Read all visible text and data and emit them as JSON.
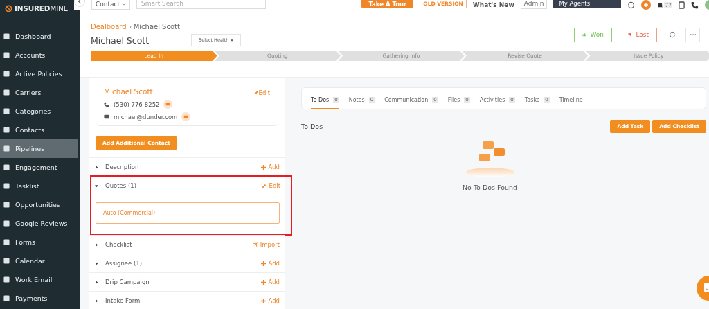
{
  "brand": {
    "name_bold": "INSURED",
    "name_light": "MINE"
  },
  "sidebar": {
    "items": [
      {
        "label": "Dashboard",
        "selected": false
      },
      {
        "label": "Accounts",
        "selected": false
      },
      {
        "label": "Active Policies",
        "selected": false
      },
      {
        "label": "Carriers",
        "selected": false
      },
      {
        "label": "Categories",
        "selected": false
      },
      {
        "label": "Contacts",
        "selected": false
      },
      {
        "label": "Pipelines",
        "selected": true
      },
      {
        "label": "Engagement",
        "selected": false
      },
      {
        "label": "Tasklist",
        "selected": false
      },
      {
        "label": "Opportunities",
        "selected": false
      },
      {
        "label": "Google Reviews",
        "selected": false
      },
      {
        "label": "Forms",
        "selected": false
      },
      {
        "label": "Calendar",
        "selected": false
      },
      {
        "label": "Work Email",
        "selected": false
      },
      {
        "label": "Payments",
        "selected": false
      }
    ]
  },
  "topbar": {
    "search_type": "Contact",
    "search_placeholder": "Smart Search",
    "tour": "Take A Tour",
    "old_version": "OLD VERSION",
    "whats_new": "What's New",
    "role": "Admin",
    "agents": "My Agents",
    "notifications": "77"
  },
  "breadcrumb": {
    "parent": "Dealboard",
    "current": "Michael Scott"
  },
  "title": "Michael Scott",
  "health": "Select Health",
  "actions": {
    "won": "Won",
    "lost": "Lost"
  },
  "stages": [
    {
      "label": "Lead In",
      "selected": true
    },
    {
      "label": "Quoting",
      "selected": false
    },
    {
      "label": "Gathering Info",
      "selected": false
    },
    {
      "label": "Revise Quote",
      "selected": false
    },
    {
      "label": "Issue Policy",
      "selected": false
    }
  ],
  "contact": {
    "name": "Michael Scott",
    "edit": "Edit",
    "phone": "(530) 776-8252",
    "email": "michael@dunder.com"
  },
  "add_contact": "Add Additional Contact",
  "sections": [
    {
      "label": "Description",
      "action": "Add",
      "kind": "add",
      "expanded": false,
      "highlighted": false
    },
    {
      "label": "Quotes (1)",
      "action": "Edit",
      "kind": "edit",
      "expanded": true,
      "highlighted": true,
      "items": [
        "Auto (Commercial)"
      ]
    },
    {
      "label": "Checklist",
      "action": "Import",
      "kind": "import",
      "expanded": false,
      "highlighted": false
    },
    {
      "label": "Assignee (1)",
      "action": "Add",
      "kind": "add",
      "expanded": false,
      "highlighted": false
    },
    {
      "label": "Drip Campaign",
      "action": "Add",
      "kind": "add",
      "expanded": false,
      "highlighted": false
    },
    {
      "label": "Intake Form",
      "action": "Add",
      "kind": "add",
      "expanded": false,
      "highlighted": false
    }
  ],
  "tabs": [
    {
      "label": "To Dos",
      "count": "0",
      "selected": true
    },
    {
      "label": "Notes",
      "count": "0",
      "selected": false
    },
    {
      "label": "Communication",
      "count": "0",
      "selected": false
    },
    {
      "label": "Files",
      "count": "0",
      "selected": false
    },
    {
      "label": "Activities",
      "count": "0",
      "selected": false
    },
    {
      "label": "Tasks",
      "count": "0",
      "selected": false
    },
    {
      "label": "Timeline",
      "selected": false
    }
  ],
  "panel": {
    "title": "To Dos",
    "buttons": [
      "Add Task",
      "Add Checklist"
    ],
    "empty": "No To Dos Found"
  }
}
